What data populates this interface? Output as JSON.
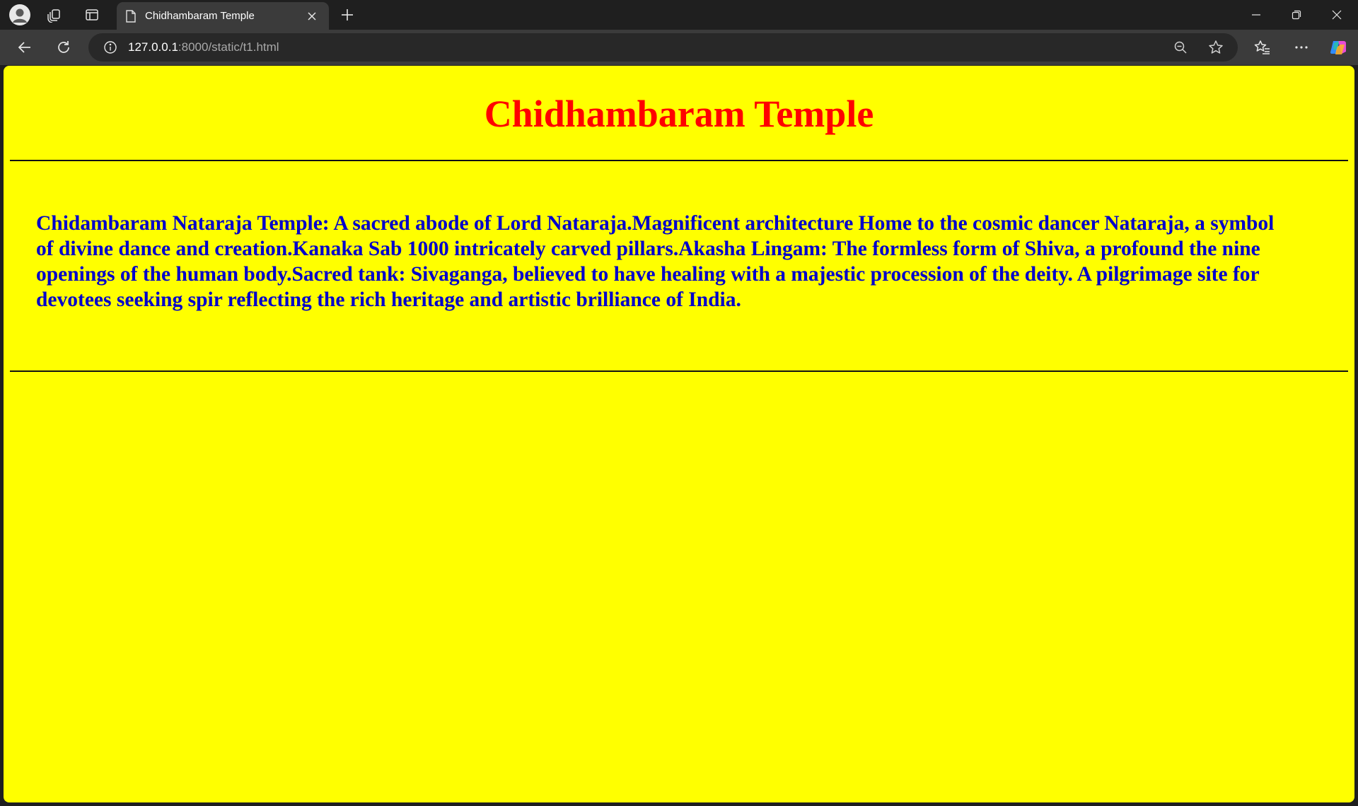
{
  "browser": {
    "tab": {
      "title": "Chidhambaram Temple"
    },
    "address": {
      "host": "127.0.0.1",
      "rest": ":8000/static/t1.html"
    }
  },
  "colors": {
    "page_background": "#ffff00",
    "heading": "#ff0000",
    "body_text": "#0000cc"
  },
  "icons": [
    "profile-icon",
    "workspaces-icon",
    "tab-actions-icon",
    "page-icon",
    "close-icon",
    "plus-icon",
    "minimize-icon",
    "restore-icon",
    "window-close-icon",
    "back-icon",
    "refresh-icon",
    "info-icon",
    "zoom-out-icon",
    "star-icon",
    "favorites-icon",
    "more-icon",
    "copilot-icon"
  ],
  "page": {
    "heading": "Chidhambaram Temple",
    "paragraph": "Chidambaram Nataraja Temple: A sacred abode of Lord Nataraja.Magnificent architecture Home to the cosmic dancer Nataraja, a symbol of divine dance and creation.Kanaka Sab 1000 intricately carved pillars.Akasha Lingam: The formless form of Shiva, a profound the nine openings of the human body.Sacred tank: Sivaganga, believed to have healing with a majestic procession of the deity. A pilgrimage site for devotees seeking spir reflecting the rich heritage and artistic brilliance of India."
  }
}
